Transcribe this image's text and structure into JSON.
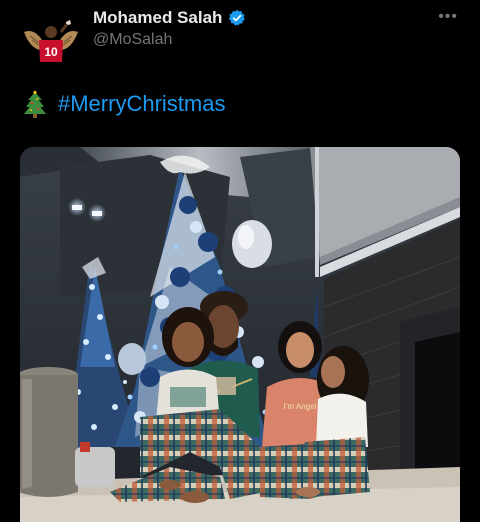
{
  "tweet": {
    "author_name": "Mohamed Salah",
    "author_handle": "@MoSalah",
    "more_label": "•••",
    "hashtag": "#MerryChristmas",
    "jersey_number": "10",
    "sweater_text": "I'm Angel"
  },
  "icons": {
    "verified": "verified-badge-icon",
    "tree": "christmas-tree-emoji",
    "more": "more-options-icon"
  },
  "colors": {
    "background": "#000000",
    "text_primary": "#e7e9ea",
    "text_secondary": "#71767b",
    "accent": "#1d9bf0"
  }
}
